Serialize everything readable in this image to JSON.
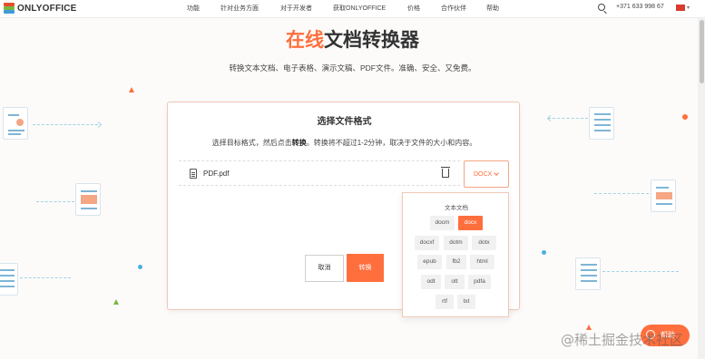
{
  "header": {
    "logo_text": "ONLYOFFICE",
    "nav": [
      "功能",
      "针对业务方面",
      "对于开发者",
      "获取ONLYOFFICE",
      "价格",
      "合作伙伴",
      "帮助"
    ],
    "phone": "+371 633 998 67"
  },
  "hero": {
    "title_accent": "在线",
    "title_rest": "文档转换器",
    "subtitle": "转换文本文档、电子表格、演示文稿、PDF文件。准确、安全、又免费。"
  },
  "converter": {
    "title": "选择文件格式",
    "desc_part1": "选择目标格式，然后点击",
    "desc_bold": "转换",
    "desc_part2": "。转换将不超过1-2分钟，取决于文件的大小和内容。",
    "file_name": "PDF.pdf",
    "selected_format": "DOCX",
    "cancel_label": "取消",
    "convert_label": "转换"
  },
  "dropdown": {
    "group_label": "文本文档",
    "options": [
      "docm",
      "docx",
      "docxf",
      "dotm",
      "dotx",
      "epub",
      "fb2",
      "html",
      "odt",
      "ott",
      "pdfa",
      "rtf",
      "txt"
    ],
    "active": "docx"
  },
  "chat": {
    "label": "帮助"
  },
  "watermark": "@稀土掘金技术社区",
  "colors": {
    "accent": "#ff6f3d",
    "deco_blue": "#9fd3e6"
  }
}
